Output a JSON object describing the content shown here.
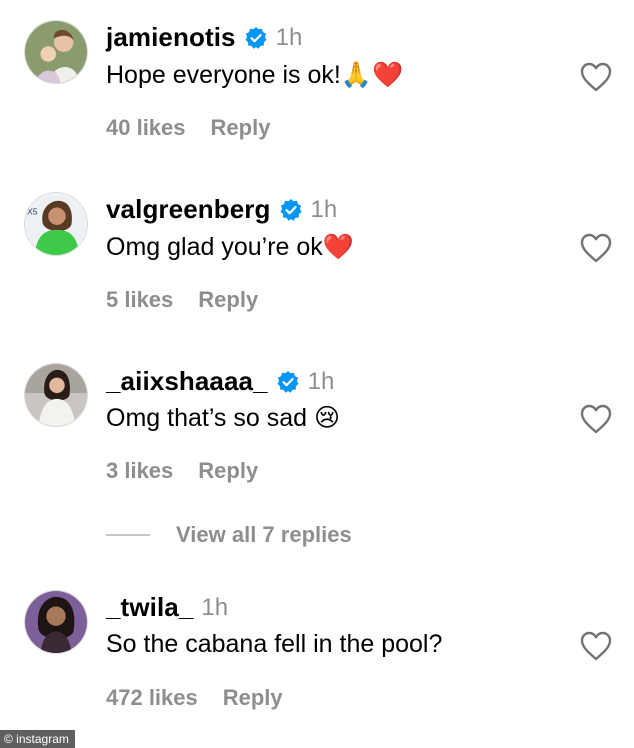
{
  "comments": [
    {
      "username": "jamienotis",
      "verified": true,
      "time": "1h",
      "text": "Hope everyone is ok!",
      "emoji": "🙏❤️",
      "likes": "40 likes",
      "reply": "Reply"
    },
    {
      "username": "valgreenberg",
      "verified": true,
      "time": "1h",
      "text": "Omg glad you’re ok",
      "emoji": "❤️",
      "likes": "5 likes",
      "reply": "Reply"
    },
    {
      "username": "_aiixshaaaa_",
      "verified": true,
      "time": "1h",
      "text": "Omg that’s so sad ",
      "emoji": "😢",
      "likes": "3 likes",
      "reply": "Reply"
    },
    {
      "username": "_twila_",
      "verified": false,
      "time": "1h",
      "text": "So the cabana fell in the pool?",
      "emoji": "",
      "likes": "472 likes",
      "reply": "Reply"
    }
  ],
  "view_replies": "View all 7 replies",
  "watermark": "© instagram",
  "colors": {
    "text": "#000000",
    "secondary": "#8e8e8e",
    "verified": "#0095f6",
    "divider": "#c7c7c7"
  },
  "icons": {
    "verified": "verified-badge-icon",
    "like": "heart-outline-icon"
  }
}
